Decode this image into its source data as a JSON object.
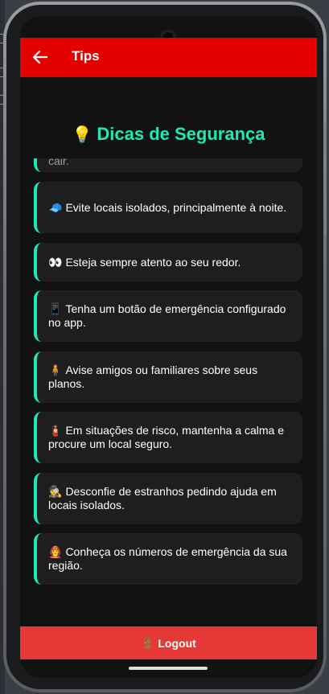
{
  "appbar": {
    "title": "Tips"
  },
  "section": {
    "title_icon": "💡",
    "title": "Dicas de Segurança"
  },
  "tips": [
    {
      "icon": "",
      "text": "cair."
    },
    {
      "icon": "🧢",
      "text": "Evite locais isolados, principalmente à noite."
    },
    {
      "icon": "👀",
      "text": "Esteja sempre atento ao seu redor."
    },
    {
      "icon": "📱",
      "text": "Tenha um botão de emergência configurado no app."
    },
    {
      "icon": "🧍",
      "text": "Avise amigos ou familiares sobre seus planos."
    },
    {
      "icon": "🧯",
      "text": "Em situações de risco, mantenha a calma e procure um local seguro."
    },
    {
      "icon": "🕵",
      "text": "Desconfie de estranhos pedindo ajuda em locais isolados."
    },
    {
      "icon": "👩‍🚒",
      "text": "Conheça os números de emergência da sua região."
    }
  ],
  "logout": {
    "icon": "🚪",
    "label": "Logout"
  },
  "colors": {
    "appbar": "#e50000",
    "accent": "#1de9b6",
    "card": "#1e1e1e",
    "background": "#121212",
    "logout": "#e53935"
  }
}
